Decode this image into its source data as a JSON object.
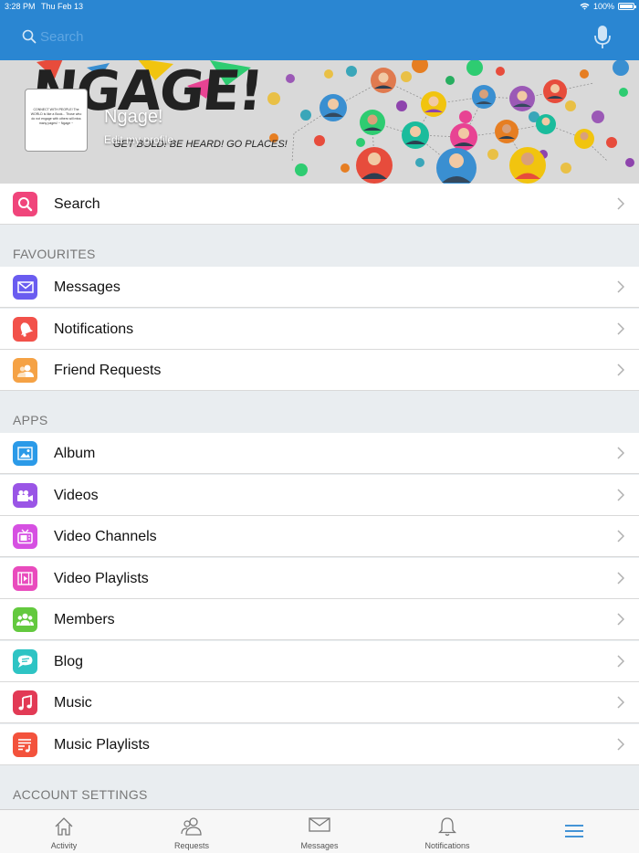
{
  "status_bar": {
    "time": "3:28 PM",
    "date": "Thu Feb 13",
    "battery": "100%"
  },
  "header": {
    "search_placeholder": "Search"
  },
  "profile": {
    "name": "Ngage!",
    "edit_label": "Edit my profile",
    "banner_title": "NGAGE!",
    "banner_tagline": "GET BOLD! BE HEARD! GO PLACES!",
    "thumb_text": "CONNECT WITH PEOPLE! The WORLD is like a Book... Those who do not engage with others will miss many pages! ~ Ngage ~"
  },
  "search_row": {
    "label": "Search",
    "icon": "search-icon",
    "color": "#f0457b"
  },
  "sections": {
    "favourites": "FAVOURITES",
    "apps": "APPS",
    "account": "ACCOUNT SETTINGS"
  },
  "favourites": [
    {
      "label": "Messages",
      "icon": "envelope-icon",
      "color": "#6a5cf0"
    },
    {
      "label": "Notifications",
      "icon": "bell-icon",
      "color": "#f2514a"
    },
    {
      "label": "Friend Requests",
      "icon": "friends-icon",
      "color": "#f5a245"
    }
  ],
  "apps": [
    {
      "label": "Album",
      "icon": "photo-icon",
      "color": "#2b9ae8"
    },
    {
      "label": "Videos",
      "icon": "video-camera-icon",
      "color": "#9a55e6"
    },
    {
      "label": "Video Channels",
      "icon": "tv-icon",
      "color": "#d650e2"
    },
    {
      "label": "Video Playlists",
      "icon": "video-playlist-icon",
      "color": "#e94bbd"
    },
    {
      "label": "Members",
      "icon": "members-icon",
      "color": "#63c93e"
    },
    {
      "label": "Blog",
      "icon": "blog-icon",
      "color": "#2ec4c4"
    },
    {
      "label": "Music",
      "icon": "music-note-icon",
      "color": "#e23a55"
    },
    {
      "label": "Music Playlists",
      "icon": "music-playlist-icon",
      "color": "#f3523c"
    }
  ],
  "tabbar": [
    {
      "label": "Activity",
      "icon": "home-icon"
    },
    {
      "label": "Requests",
      "icon": "requests-icon"
    },
    {
      "label": "Messages",
      "icon": "envelope-icon"
    },
    {
      "label": "Notifications",
      "icon": "bell-icon"
    },
    {
      "label": "",
      "icon": "hamburger-menu-icon",
      "color": "#2a86d2"
    }
  ]
}
